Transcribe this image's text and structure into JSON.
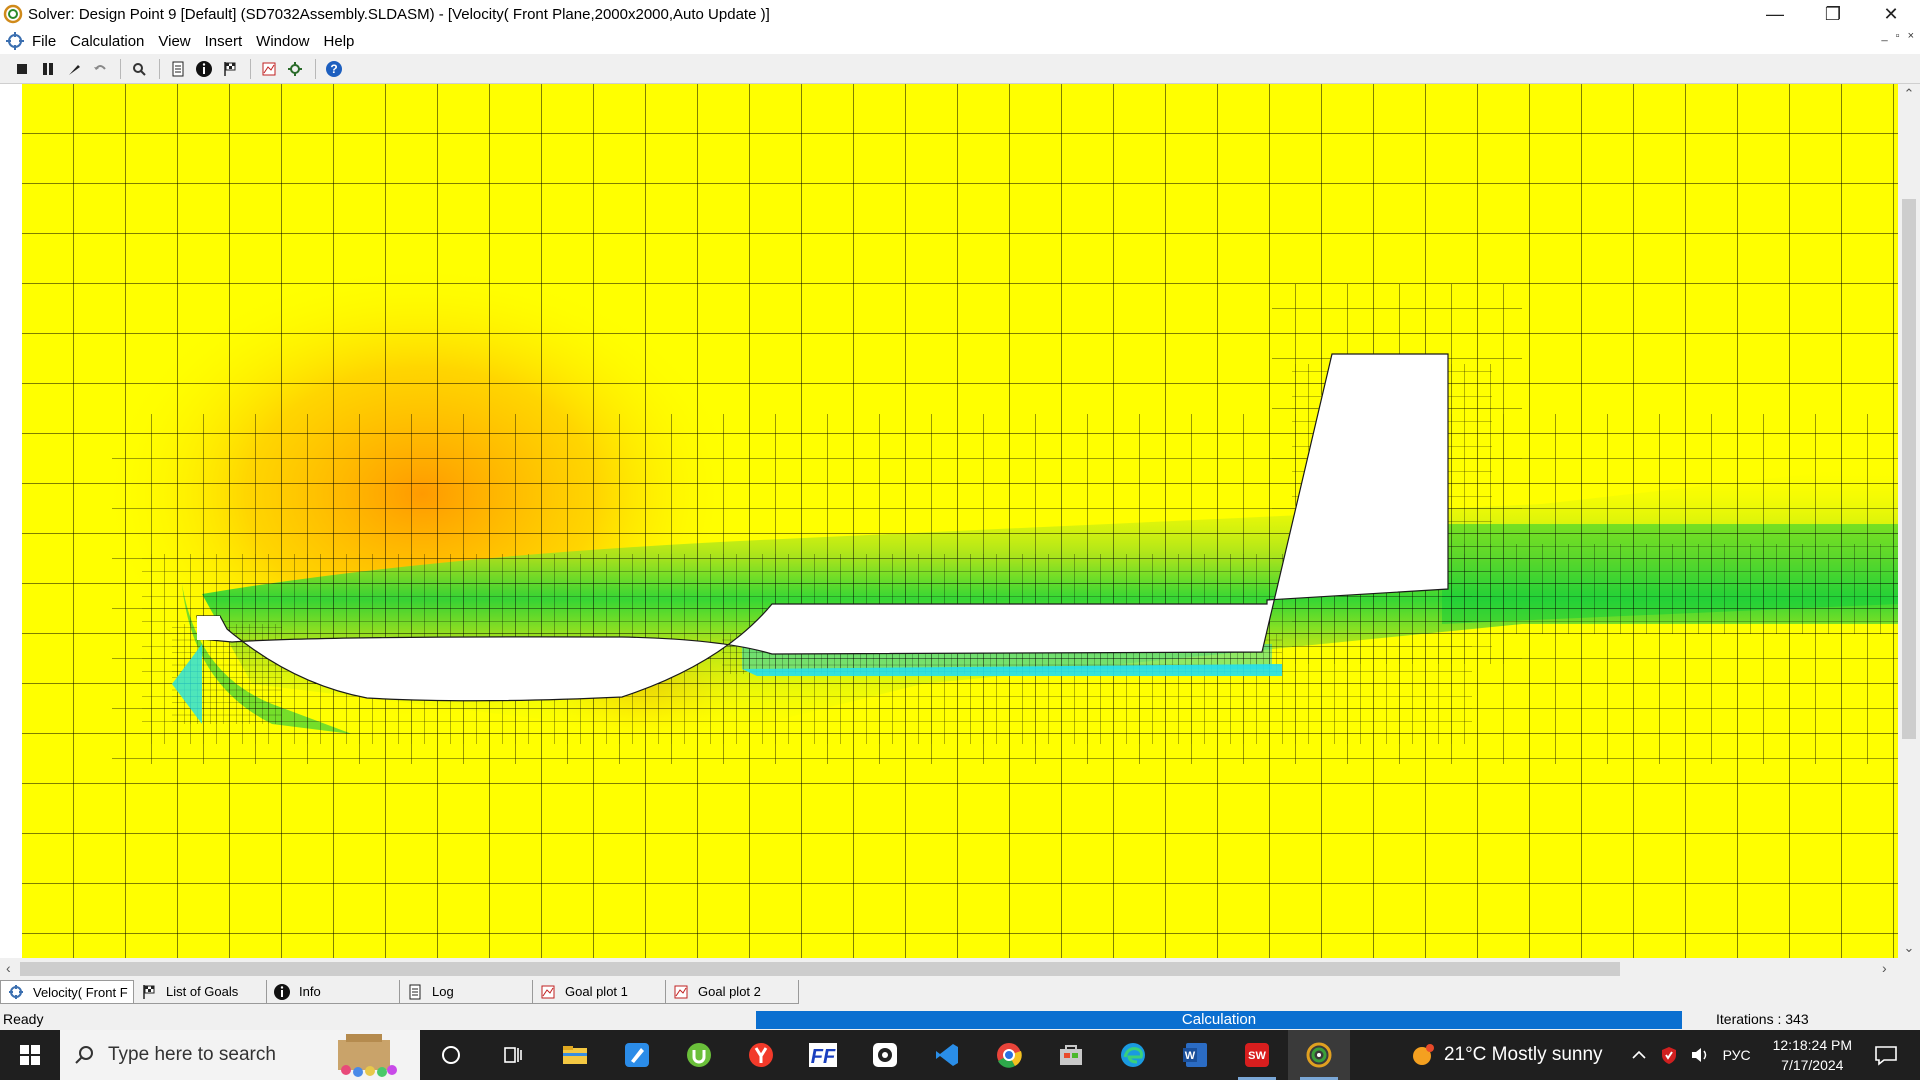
{
  "window": {
    "title": "Solver: Design Point 9 [Default] (SD7032Assembly.SLDASM) - [Velocity( Front Plane,2000x2000,Auto Update )]",
    "controls": [
      "—",
      "❐",
      "✕"
    ]
  },
  "menu": {
    "items": [
      "File",
      "Calculation",
      "View",
      "Insert",
      "Window",
      "Help"
    ],
    "mdi_controls": [
      "_",
      "▫",
      "×"
    ]
  },
  "toolbar": {
    "buttons": [
      "stop-icon",
      "pause-icon",
      "probe-icon",
      "undo-icon",
      "zoom-icon",
      "file-info-icon",
      "info-icon",
      "goals-icon",
      "goal-plot-icon",
      "settings-icon",
      "help-icon"
    ]
  },
  "plot": {
    "palette": {
      "base": "#ffff00",
      "high": "#ff9900",
      "low_green": "#19d232",
      "low_cyan": "#20e0e8"
    }
  },
  "tabs": [
    {
      "label": "Velocity( Front F",
      "icon": "solver-icon",
      "active": true
    },
    {
      "label": "List of Goals",
      "icon": "goals-icon",
      "active": false
    },
    {
      "label": "Info",
      "icon": "info-icon",
      "active": false
    },
    {
      "label": "Log",
      "icon": "log-icon",
      "active": false
    },
    {
      "label": "Goal plot 1",
      "icon": "goal-plot-icon",
      "active": false
    },
    {
      "label": "Goal plot 2",
      "icon": "goal-plot-icon",
      "active": false
    }
  ],
  "status": {
    "left": "Ready",
    "progress_label": "Calculation",
    "iterations": "Iterations : 343"
  },
  "taskbar": {
    "search_placeholder": "Type here to search",
    "apps": [
      "cortana-icon",
      "task-view-icon",
      "file-explorer-icon",
      "sketch-app-icon",
      "utorrent-icon",
      "yandex-browser-icon",
      "far-manager-icon",
      "obs-icon",
      "vscode-icon",
      "chrome-icon",
      "store-icon",
      "edge-icon",
      "word-icon",
      "solidworks-icon",
      "flow-simulation-icon"
    ],
    "weather": "21°C  Mostly sunny",
    "lang": "РУС",
    "time": "12:18:24 PM",
    "date": "7/17/2024"
  }
}
